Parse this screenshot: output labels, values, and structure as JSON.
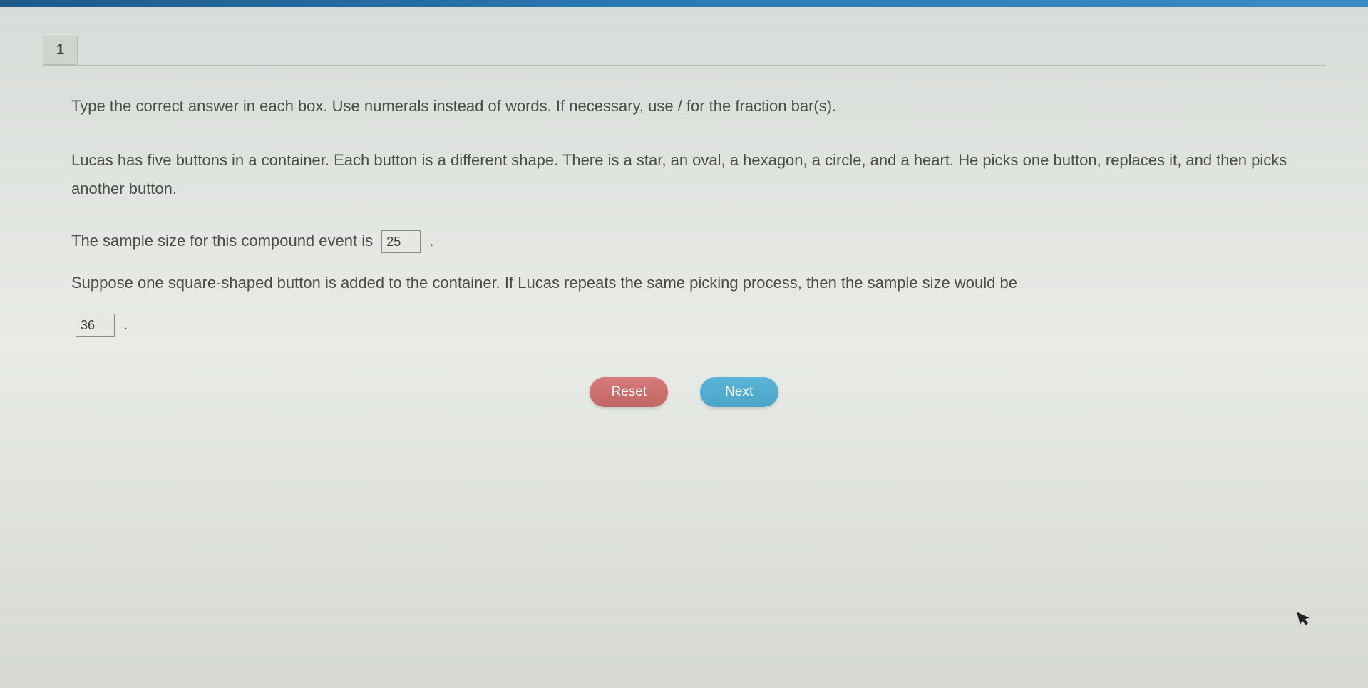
{
  "question": {
    "number": "1",
    "instruction": "Type the correct answer in each box. Use numerals instead of words. If necessary, use / for the fraction bar(s).",
    "problem": "Lucas has five buttons in a container. Each button is a different shape. There is a star, an oval, a hexagon, a circle, and a heart. He picks one button, replaces it, and then picks another button.",
    "line1_before": "The sample size for this compound event is",
    "line1_after": ".",
    "answer1": "25",
    "line2": "Suppose one square-shaped button is added to the container. If Lucas repeats the same picking process, then the sample size would be",
    "answer2": "36",
    "line2_after": "."
  },
  "buttons": {
    "reset": "Reset",
    "next": "Next"
  }
}
